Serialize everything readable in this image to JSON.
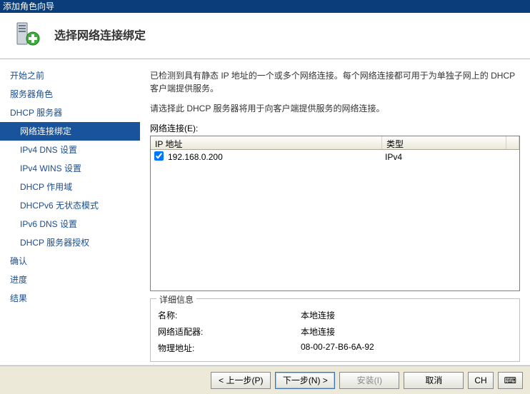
{
  "window": {
    "title": "添加角色向导"
  },
  "header": {
    "title": "选择网络连接绑定"
  },
  "sidebar": {
    "items": [
      {
        "label": "开始之前",
        "sub": false
      },
      {
        "label": "服务器角色",
        "sub": false
      },
      {
        "label": "DHCP 服务器",
        "sub": false
      },
      {
        "label": "网络连接绑定",
        "sub": true,
        "selected": true
      },
      {
        "label": "IPv4 DNS 设置",
        "sub": true
      },
      {
        "label": "IPv4 WINS 设置",
        "sub": true
      },
      {
        "label": "DHCP 作用域",
        "sub": true
      },
      {
        "label": "DHCPv6 无状态模式",
        "sub": true
      },
      {
        "label": "IPv6 DNS 设置",
        "sub": true
      },
      {
        "label": "DHCP 服务器授权",
        "sub": true
      },
      {
        "label": "确认",
        "sub": false
      },
      {
        "label": "进度",
        "sub": false
      },
      {
        "label": "结果",
        "sub": false
      }
    ]
  },
  "main": {
    "desc1": "已检测到具有静态 IP 地址的一个或多个网络连接。每个网络连接都可用于为单独子网上的 DHCP 客户端提供服务。",
    "desc2": "请选择此 DHCP 服务器将用于向客户端提供服务的网络连接。",
    "list_label": "网络连接(E):",
    "columns": {
      "ip": "IP 地址",
      "type": "类型"
    },
    "rows": [
      {
        "ip": "192.168.0.200",
        "type": "IPv4",
        "checked": true
      }
    ],
    "details": {
      "legend": "详细信息",
      "name_label": "名称:",
      "name_value": "本地连接",
      "adapter_label": "网络适配器:",
      "adapter_value": "本地连接",
      "mac_label": "物理地址:",
      "mac_value": "08-00-27-B6-6A-92"
    }
  },
  "footer": {
    "prev": "< 上一步(P)",
    "next": "下一步(N) >",
    "install": "安装(I)",
    "cancel": "取消",
    "ch": "CH",
    "ime": "⌨"
  }
}
